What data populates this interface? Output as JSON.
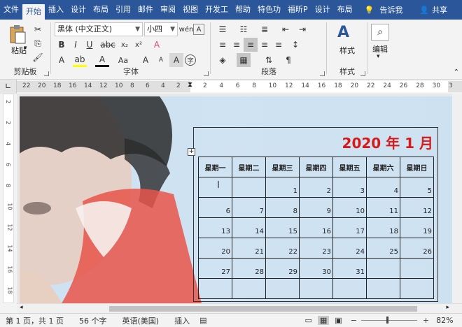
{
  "tabs": [
    "文件",
    "开始",
    "插入",
    "设计",
    "布局",
    "引用",
    "邮件",
    "审阅",
    "视图",
    "开发工",
    "帮助",
    "特色功",
    "福昕P",
    "设计",
    "布局"
  ],
  "tell_me": "告诉我",
  "share": "共享",
  "ribbon": {
    "clipboard": {
      "paste": "粘贴",
      "label": "剪贴板"
    },
    "font": {
      "name": "黑体 (中文正文)",
      "size": "小四",
      "label": "字体"
    },
    "paragraph": {
      "label": "段落"
    },
    "styles": {
      "button": "样式",
      "label": "样式"
    },
    "editing": {
      "button": "编辑"
    }
  },
  "ruler": {
    "h_left": [
      "22",
      "20",
      "18",
      "16",
      "14",
      "12",
      "10",
      "8",
      "6",
      "4",
      "2"
    ],
    "h_right": [
      "2",
      "4",
      "6",
      "8",
      "10",
      "12",
      "14",
      "16",
      "18",
      "20",
      "22",
      "24",
      "26",
      "28",
      "30",
      "3"
    ],
    "v": [
      "2",
      "2",
      "4",
      "6",
      "8",
      "10",
      "12",
      "14",
      "16",
      "18"
    ]
  },
  "calendar": {
    "title": "2020 年 1 月",
    "weekdays": [
      "星期一",
      "星期二",
      "星期三",
      "星期四",
      "星期五",
      "星期六",
      "星期日"
    ],
    "weeks": [
      [
        "",
        "",
        "1",
        "2",
        "3",
        "4",
        "5"
      ],
      [
        "6",
        "7",
        "8",
        "9",
        "10",
        "11",
        "12"
      ],
      [
        "13",
        "14",
        "15",
        "16",
        "17",
        "18",
        "19"
      ],
      [
        "20",
        "21",
        "22",
        "23",
        "24",
        "25",
        "26"
      ],
      [
        "27",
        "28",
        "29",
        "30",
        "31",
        "",
        ""
      ],
      [
        "",
        "",
        "",
        "",
        "",
        "",
        ""
      ]
    ]
  },
  "status": {
    "page": "第 1 页，共 1 页",
    "words": "56 个字",
    "lang": "英语(美国)",
    "mode": "插入",
    "zoom": "82%"
  },
  "colors": {
    "accent": "#2b579a",
    "title_red": "#d61a1a"
  }
}
